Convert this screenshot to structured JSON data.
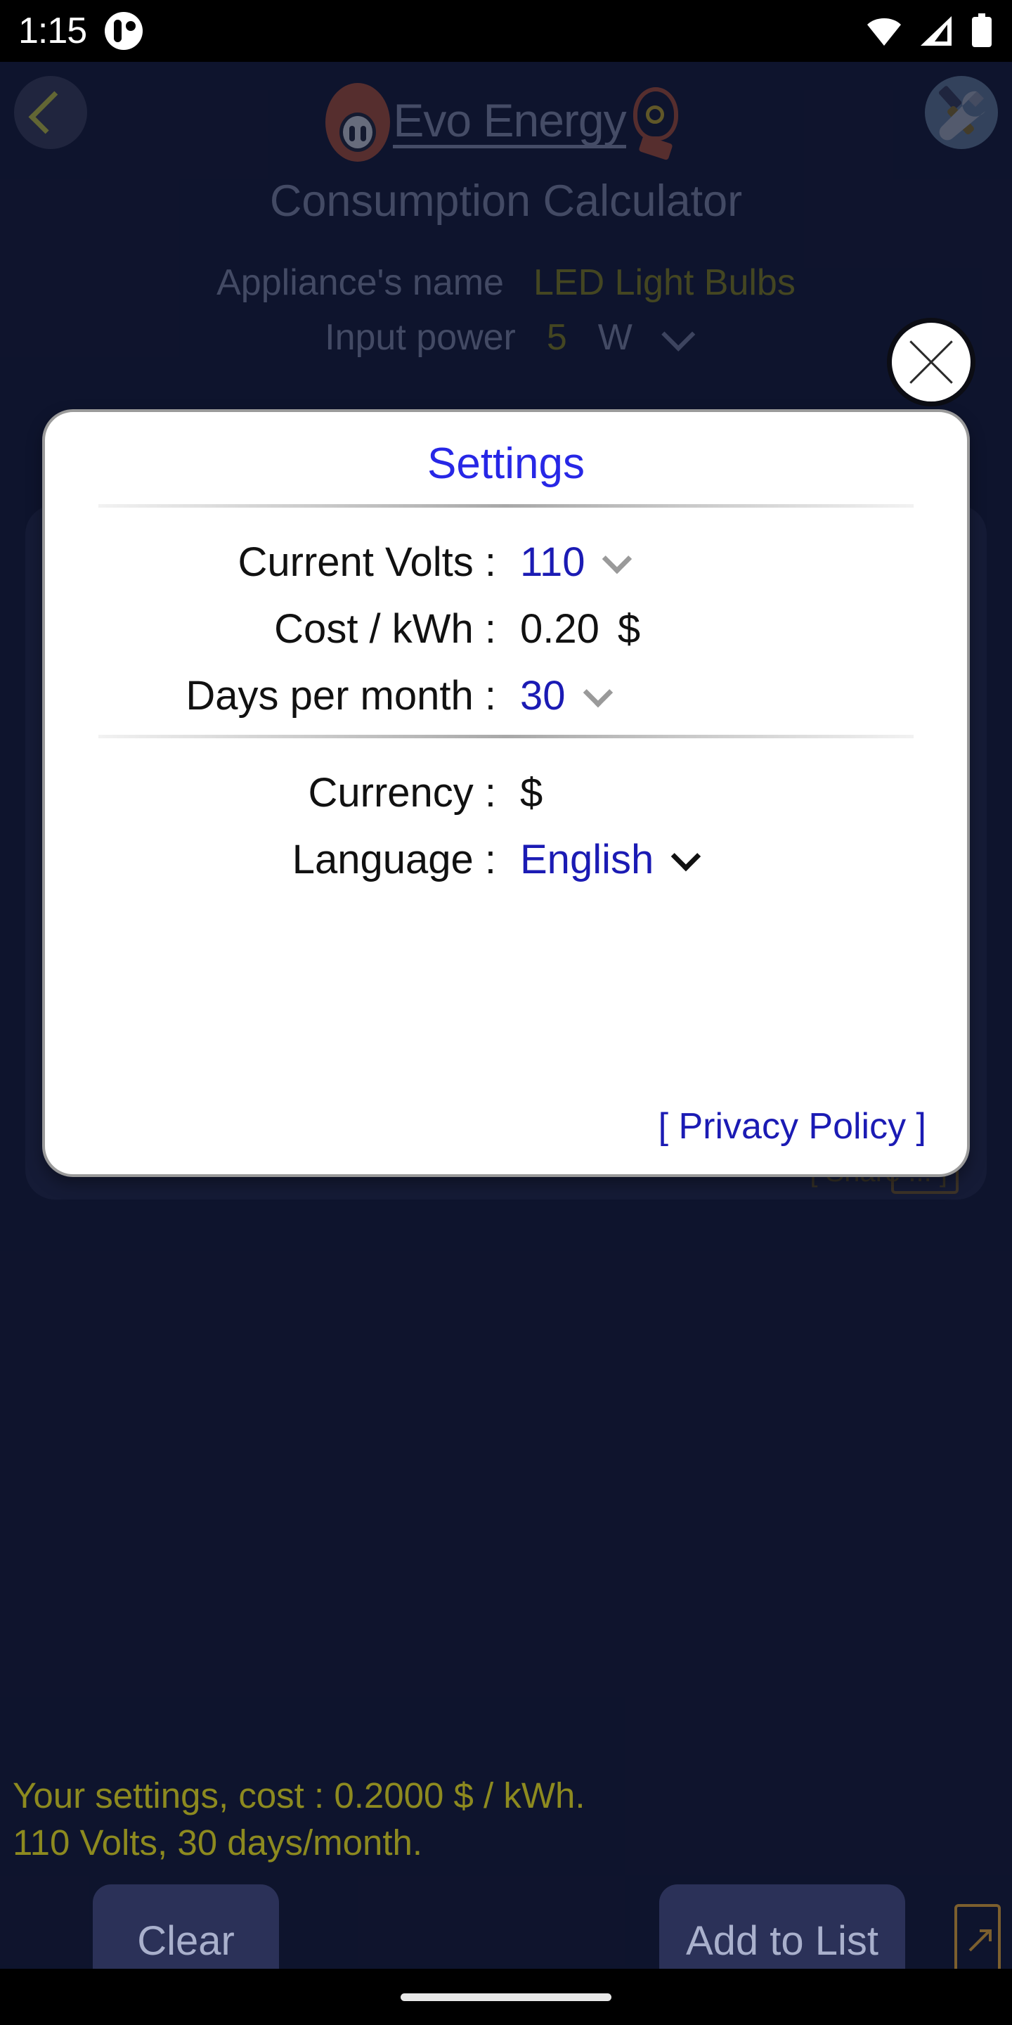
{
  "status_bar": {
    "time": "1:15",
    "notification_icon": "notification-dot-icon",
    "wifi_icon": "wifi-icon",
    "signal_icon": "cell-signal-icon",
    "battery_icon": "battery-icon"
  },
  "header": {
    "back_icon": "chevron-left-icon",
    "brand_text": "Evo Energy",
    "brand_plug_icon": "power-plug-icon",
    "brand_bulb_icon": "light-bulb-icon",
    "settings_icon": "tools-wrench-screwdriver-icon"
  },
  "page": {
    "title": "Consumption Calculator"
  },
  "appliance": {
    "name_label": "Appliance's name",
    "name_value": "LED Light Bulbs",
    "power_label": "Input power",
    "power_value": "5",
    "power_unit": "W",
    "power_unit_chevron": "chevron-down-icon"
  },
  "background_card": {
    "hidden_text": "[ Share ... ]"
  },
  "dialog": {
    "title": "Settings",
    "close_icon": "close-x-icon",
    "rows": [
      {
        "label": "Current Volts :",
        "value": "110",
        "unit": "",
        "chevron": "chevron-down-icon",
        "value_color": "#1b1bb4"
      },
      {
        "label": "Cost / kWh :",
        "value": "0.20",
        "unit": "$",
        "chevron": "",
        "value_color": "#111111"
      },
      {
        "label": "Days per month :",
        "value": "30",
        "unit": "",
        "chevron": "chevron-down-icon",
        "value_color": "#1b1bb4"
      },
      {
        "label": "Currency :",
        "value": "$",
        "unit": "",
        "chevron": "",
        "value_color": "#111111"
      },
      {
        "label": "Language :",
        "value": "English",
        "unit": "",
        "chevron": "chevron-down-icon",
        "value_color": "#1b1bb4"
      }
    ],
    "privacy_policy": "[ Privacy Policy ]"
  },
  "footer": {
    "summary_line1": "Your settings, cost : 0.2000 $ / kWh.",
    "summary_line2": "110 Volts, 30 days/month.",
    "clear_label": "Clear",
    "add_to_list_label": "Add to List",
    "share_icon": "share-arrow-icon"
  },
  "colors": {
    "app_background": "#141a38",
    "card_background": "#242a4e",
    "accent_yellow": "#8d8a1f",
    "accent_blue": "#1b1bb4",
    "title_blue": "#2727e6",
    "muted_text": "#8a93b4"
  }
}
